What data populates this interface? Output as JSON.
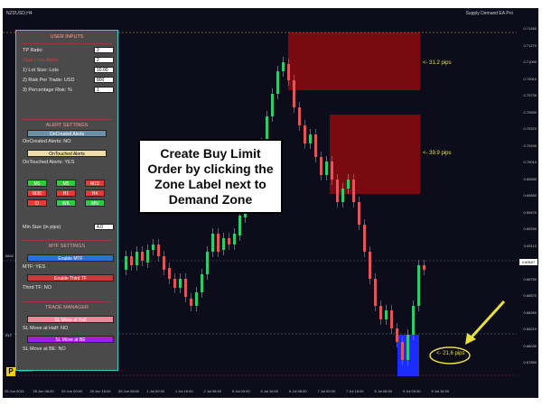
{
  "chart": {
    "symbol": "NZDUSD,H4",
    "indicator_name": "Supply Demand EA Pro",
    "current_price": "0.69507",
    "price_labels": [
      "0.71450",
      "0.71270",
      "0.71090",
      "0.70910",
      "0.70730",
      "0.70550",
      "0.70370",
      "0.70190",
      "0.70010",
      "0.69830",
      "0.69650",
      "0.69470",
      "0.69290",
      "0.69110",
      "0.68930",
      "0.68750",
      "0.68570",
      "0.68390",
      "0.68210",
      "0.68030",
      "0.67850"
    ],
    "time_labels": [
      "25 Jun 2021",
      "28 Jun 08:00",
      "29 Jun 00:00",
      "29 Jun 16:00",
      "30 Jun 08:00",
      "1 Jul 00:00",
      "1 Jul 16:00",
      "2 Jul 08:00",
      "5 Jul 00:00",
      "5 Jul 16:00",
      "6 Jul 08:00",
      "7 Jul 00:00",
      "7 Jul 16:00",
      "8 Jul 08:00",
      "9 Jul 00:00",
      "9 Jul 16:00"
    ],
    "left_markers": [
      "6842",
      "642"
    ],
    "footer_label": "B5028.4",
    "zones": [
      {
        "label": "<- 31.2 pips",
        "type": "supply",
        "color": "#7a0a12"
      },
      {
        "label": "<- 39.9 pips",
        "type": "supply",
        "color": "#7a0a12"
      },
      {
        "label": "<- 21.6 pips",
        "type": "demand",
        "color": "#1a2cff"
      }
    ],
    "bull_color": "#2ecc71",
    "bear_color": "#e0565a"
  },
  "panel": {
    "user_inputs_title": "USER INPUTS",
    "rows": [
      {
        "label": "TP Ratio:",
        "value": "2",
        "label_color": "#eaeaea"
      },
      {
        "label": "Stop Loss Ratio:",
        "value": "2",
        "label_color": "#e03a3a"
      },
      {
        "label": "1) Lot Size: Lots",
        "value": "10.00",
        "label_color": "#eaeaea"
      },
      {
        "label": "2) Risk Per Trade: USD",
        "value": "800",
        "label_color": "#eaeaea"
      },
      {
        "label": "3) Percentage Risk: %",
        "value": "1",
        "label_color": "#eaeaea"
      }
    ],
    "alert_settings_title": "ALERT SETTINGS",
    "on_created_btn": "OnCreated Alerts",
    "on_created_status": "OnCreated Alerts: NO",
    "on_touched_btn": "OnTouched Alerts",
    "on_touched_status": "OnTouched Alerts: YES",
    "timeframes": [
      "M1",
      "M5",
      "M15",
      "M30",
      "H1",
      "H4",
      "D",
      "WK",
      "MN"
    ],
    "timeframe_colors": [
      "#2ecc40",
      "#2ecc40",
      "#e53a3a",
      "#e53a3a",
      "#e53a3a",
      "#e53a3a",
      "#e53a3a",
      "#2ecc40",
      "#2ecc40"
    ],
    "min_size_label": "Min Size (in pips)",
    "min_size_value": "4.0",
    "mtf_settings_title": "MTF SETTINGS",
    "enable_mtf_btn": "Enable MTF",
    "mtf_status": "MTF: YES",
    "enable_third_tf_btn": "Enable Third TF",
    "third_tf_status": "Third TF: NO",
    "trade_manager_title": "TRADE MANAGER",
    "sl_half_btn": "SL Move at Half",
    "sl_half_status": "SL Move at Half: NO",
    "sl_be_btn": "SL Move at BE",
    "sl_be_status": "SL Move at BE: NO"
  },
  "callout": {
    "text_lines": [
      "Create Buy Limit",
      "Order by clicking the",
      "Zone Label next to",
      "Demand Zone"
    ]
  },
  "logo": {
    "letter": "P"
  }
}
